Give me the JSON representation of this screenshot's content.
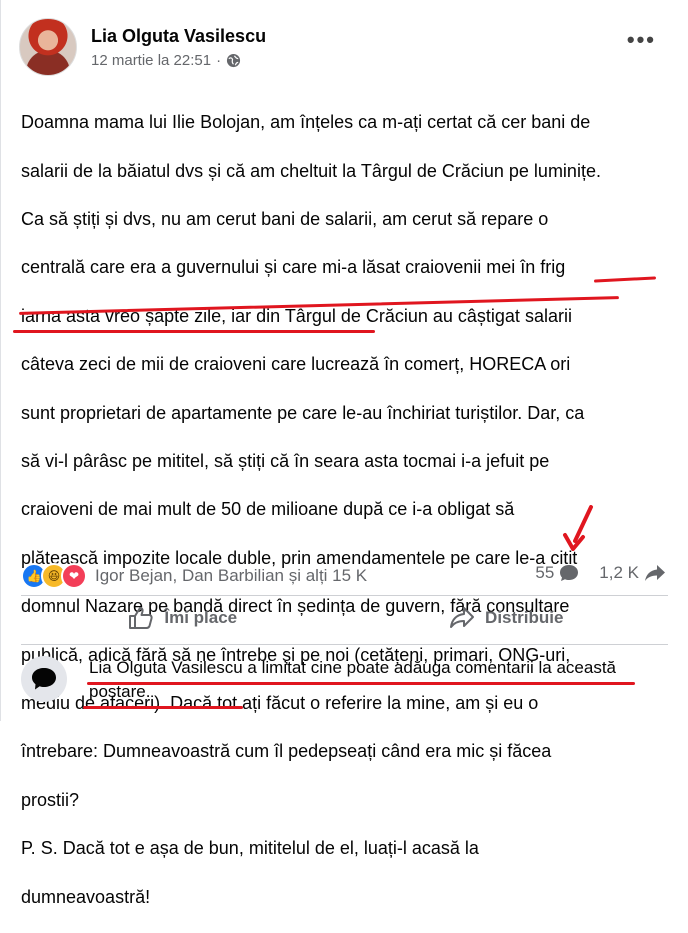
{
  "post": {
    "author": "Lia Olguta Vasilescu",
    "timestamp": "12 martie la 22:51",
    "dot": "·",
    "more_label": "•••",
    "lines": [
      "Doamna mama lui Ilie Bolojan, am înțeles ca m-ați certat că cer bani de",
      "salarii de la băiatul dvs și că am cheltuit la Târgul de Crăciun pe luminițe.",
      "Ca să știți și dvs, nu am cerut bani de salarii, am cerut să repare o",
      "centrală care era a guvernului și care mi-a lăsat craiovenii mei în frig",
      "iarna asta vreo șapte zile, iar din Târgul de Crăciun au câștigat salarii",
      "câteva zeci de mii de craioveni care lucrează în comerț, HORECA ori",
      "sunt proprietari de apartamente pe care le-au închiriat turiștilor. Dar, ca",
      "să vi-l pârâsc pe mititel, să știți că în seara asta tocmai i-a jefuit pe",
      "craioveni de mai mult de 50 de milioane după ce i-a obligat să",
      "plătească impozite locale duble, prin amendamentele pe care le-a citit",
      "domnul Nazare pe bandă direct în ședința de guvern, fără consultare",
      "publică, adică fără să ne întrebe și pe noi (cetățeni, primari, ONG-uri,",
      "mediu de afaceri). Dacă tot ați făcut o referire la mine, am și eu o",
      "întrebare: Dumneavoastră cum îl pedepseați când era mic și făcea",
      "prostii?",
      "P. S. Dacă tot e așa de bun, mititelul de el, luați-l acasă la",
      "dumneavoastră!"
    ]
  },
  "reactions": {
    "names": "Igor Bejan, Dan Barbilian și alți 15 K",
    "comments_count": "55",
    "shares_count": "1,2 K"
  },
  "actions": {
    "like_label": "Îmi place",
    "share_label": "Distribuie"
  },
  "notice": {
    "text": "Lia Olguta Vasilescu a limitat cine poate adăuga comentarii la această postare."
  },
  "colors": {
    "annotation_red": "#e0161f",
    "like_blue": "#1877f2",
    "secondary_text": "#65676b"
  }
}
